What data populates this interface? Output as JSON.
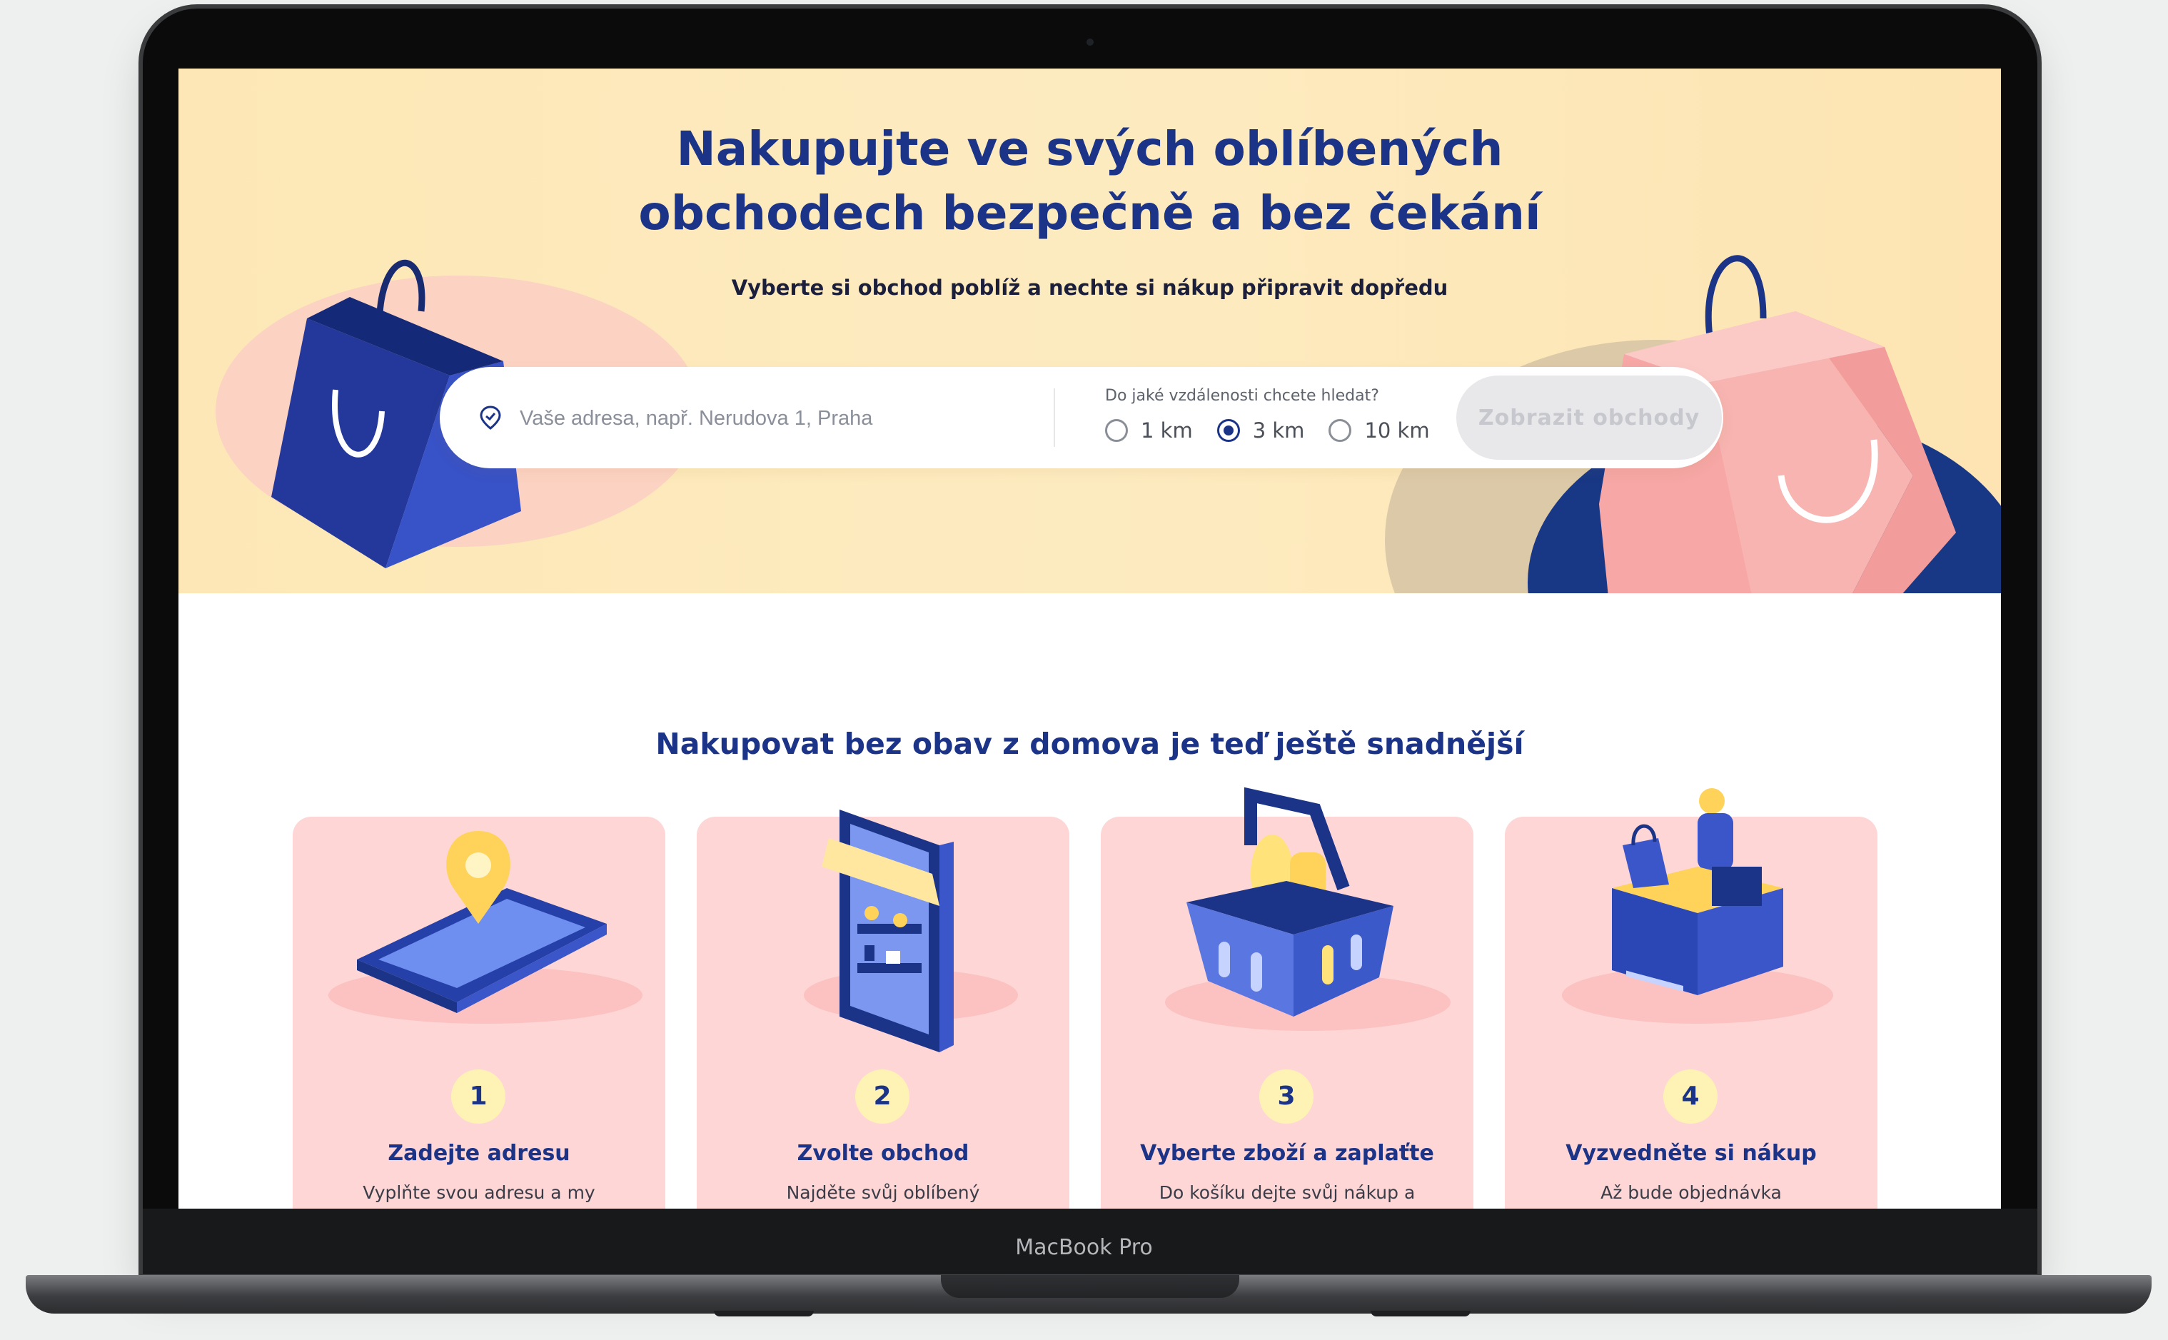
{
  "device": {
    "label": "MacBook Pro"
  },
  "hero": {
    "title_line1": "Nakupujte ve svých oblíbených",
    "title_line2": "obchodech bezpečně a bez čekání",
    "subtitle": "Vyberte si obchod poblíž a nechte si nákup připravit dopředu"
  },
  "search": {
    "placeholder": "Vaše adresa, např. Nerudova 1, Praha",
    "value": "",
    "distance_label": "Do jaké vzdálenosti chcete hledat?",
    "distances": [
      {
        "label": "1 km",
        "selected": false
      },
      {
        "label": "3 km",
        "selected": true
      },
      {
        "label": "10 km",
        "selected": false
      }
    ],
    "button_label": "Zobrazit obchody"
  },
  "steps": {
    "title": "Nakupovat bez obav z domova je teď ještě snadnější",
    "items": [
      {
        "number": "1",
        "title": "Zadejte adresu",
        "text": "Vyplňte svou adresu a my",
        "icon": "phone-location-icon"
      },
      {
        "number": "2",
        "title": "Zvolte obchod",
        "text": "Najděte svůj oblíbený",
        "icon": "phone-shop-icon"
      },
      {
        "number": "3",
        "title": "Vyberte zboží a zaplaťte",
        "text": "Do košíku dejte svůj nákup a",
        "icon": "basket-icon"
      },
      {
        "number": "4",
        "title": "Vyzvedněte si nákup",
        "text": "Až bude objednávka",
        "icon": "cashier-icon"
      }
    ]
  },
  "colors": {
    "brand": "#1b3487",
    "hero_bg": "#fde7b6",
    "card_bg": "#fed6d6",
    "badge_bg": "#fef3b4",
    "pink_bag": "#f6a8a8"
  }
}
